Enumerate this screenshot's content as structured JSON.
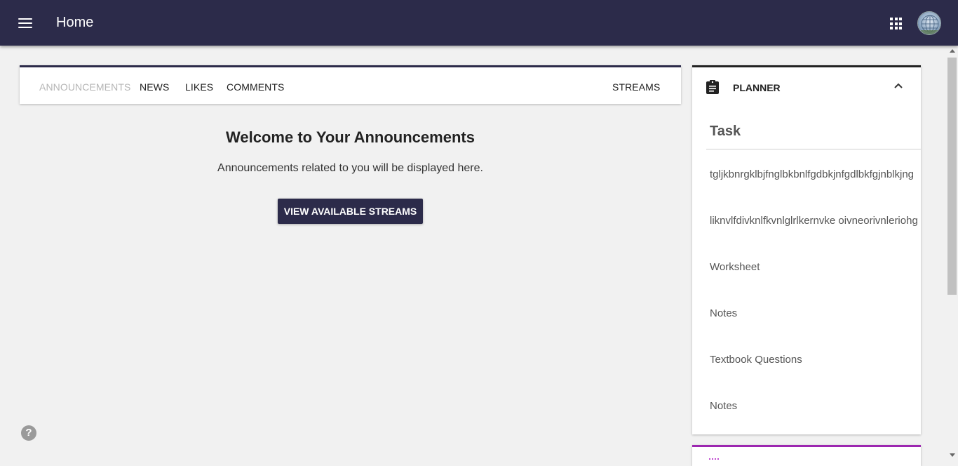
{
  "app": {
    "title": "Home"
  },
  "icons": {
    "menu": "hamburger-menu-icon",
    "apps": "apps-grid-icon",
    "avatar": "user-avatar",
    "planner": "clipboard-icon",
    "collapse": "chevron-up-icon",
    "help": "help-icon"
  },
  "colors": {
    "header": "#2c2b4a",
    "accent_purple": "#9c27b0",
    "inactive_tab": "#b5b5b5"
  },
  "tabs": {
    "items": [
      "ANNOUNCEMENTS",
      "NEWS",
      "LIKES",
      "COMMENTS"
    ],
    "right": "STREAMS",
    "active": "ANNOUNCEMENTS"
  },
  "main": {
    "heading": "Welcome to Your Announcements",
    "subtext": "Announcements related to you will be displayed here.",
    "button_label": "VIEW AVAILABLE STREAMS"
  },
  "help": {
    "label": "?"
  },
  "planner": {
    "title": "PLANNER",
    "column_header": "Task",
    "tasks": [
      "tgljkbnrgklbjfnglbkbnlfgdbkjnfgdlbkfgjnblkjng",
      "liknvlfdivknlfkvnlglrlkernvke oivneorivnleriohg",
      "Worksheet",
      "Notes",
      "Textbook Questions",
      "Notes"
    ]
  }
}
